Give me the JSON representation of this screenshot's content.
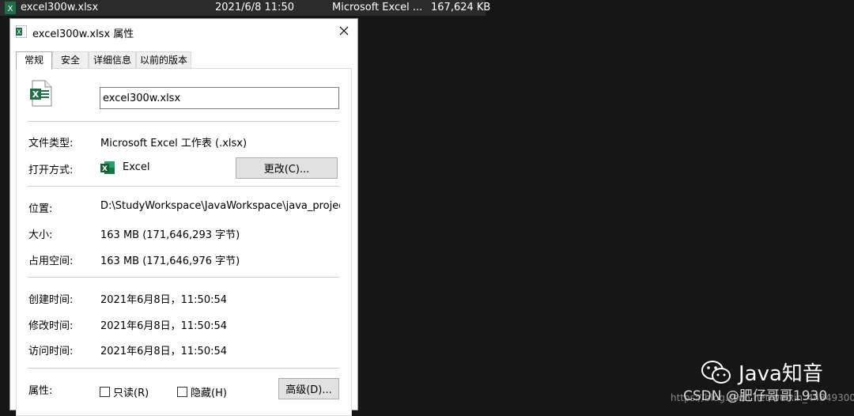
{
  "explorer_row": {
    "file_name": "excel300w.xlsx",
    "modified": "2021/6/8 11:50",
    "type": "Microsoft Excel ...",
    "size": "167,624 KB"
  },
  "dialog": {
    "title": "excel300w.xlsx 属性",
    "tabs": [
      {
        "label": "常规"
      },
      {
        "label": "安全"
      },
      {
        "label": "详细信息"
      },
      {
        "label": "以前的版本"
      }
    ],
    "file_name_value": "excel300w.xlsx",
    "fields": {
      "file_type_label": "文件类型:",
      "file_type_value": "Microsoft Excel 工作表 (.xlsx)",
      "open_with_label": "打开方式:",
      "open_with_value": "Excel",
      "change_button": "更改(C)...",
      "location_label": "位置:",
      "location_value": "D:\\StudyWorkspace\\JavaWorkspace\\java_project_w",
      "size_label": "大小:",
      "size_value": "163 MB (171,646,293 字节)",
      "size_on_disk_label": "占用空间:",
      "size_on_disk_value": "163 MB (171,646,976 字节)",
      "created_label": "创建时间:",
      "created_value": "2021年6月8日，11:50:54",
      "modified_label": "修改时间:",
      "modified_value": "2021年6月8日，11:50:54",
      "accessed_label": "访问时间:",
      "accessed_value": "2021年6月8日，11:50:54",
      "attributes_label": "属性:",
      "readonly_label": "只读(R)",
      "hidden_label": "隐藏(H)",
      "advanced_button": "高级(D)..."
    }
  },
  "watermark": {
    "brand": "Java知音",
    "url": "https://blog.csdn.net/weixin_44849300",
    "csdn": "CSDN @肥仔哥哥1930"
  },
  "colors": {
    "excel_green": "#1e7145",
    "background": "#161616",
    "row_bar": "#2b2b2b"
  }
}
